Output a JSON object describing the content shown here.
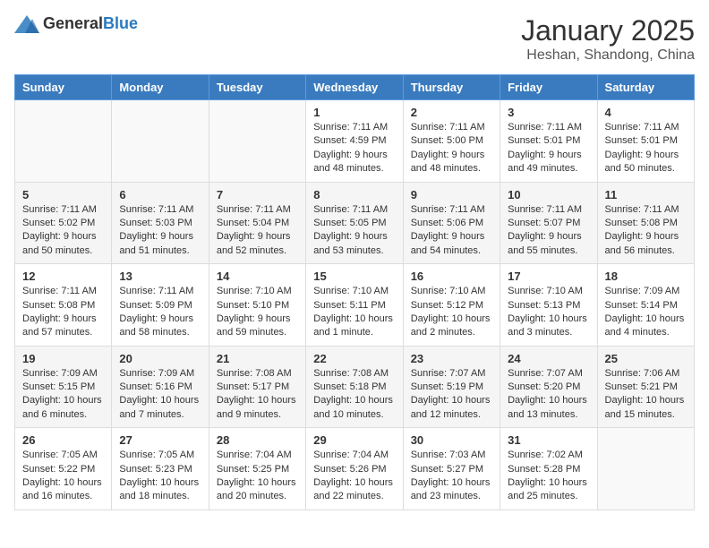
{
  "header": {
    "logo_general": "General",
    "logo_blue": "Blue",
    "month_title": "January 2025",
    "location": "Heshan, Shandong, China"
  },
  "days_of_week": [
    "Sunday",
    "Monday",
    "Tuesday",
    "Wednesday",
    "Thursday",
    "Friday",
    "Saturday"
  ],
  "weeks": [
    {
      "row_bg": "light",
      "days": [
        {
          "num": "",
          "info": ""
        },
        {
          "num": "",
          "info": ""
        },
        {
          "num": "",
          "info": ""
        },
        {
          "num": "1",
          "info": "Sunrise: 7:11 AM\nSunset: 4:59 PM\nDaylight: 9 hours and 48 minutes."
        },
        {
          "num": "2",
          "info": "Sunrise: 7:11 AM\nSunset: 5:00 PM\nDaylight: 9 hours and 48 minutes."
        },
        {
          "num": "3",
          "info": "Sunrise: 7:11 AM\nSunset: 5:01 PM\nDaylight: 9 hours and 49 minutes."
        },
        {
          "num": "4",
          "info": "Sunrise: 7:11 AM\nSunset: 5:01 PM\nDaylight: 9 hours and 50 minutes."
        }
      ]
    },
    {
      "row_bg": "dark",
      "days": [
        {
          "num": "5",
          "info": "Sunrise: 7:11 AM\nSunset: 5:02 PM\nDaylight: 9 hours and 50 minutes."
        },
        {
          "num": "6",
          "info": "Sunrise: 7:11 AM\nSunset: 5:03 PM\nDaylight: 9 hours and 51 minutes."
        },
        {
          "num": "7",
          "info": "Sunrise: 7:11 AM\nSunset: 5:04 PM\nDaylight: 9 hours and 52 minutes."
        },
        {
          "num": "8",
          "info": "Sunrise: 7:11 AM\nSunset: 5:05 PM\nDaylight: 9 hours and 53 minutes."
        },
        {
          "num": "9",
          "info": "Sunrise: 7:11 AM\nSunset: 5:06 PM\nDaylight: 9 hours and 54 minutes."
        },
        {
          "num": "10",
          "info": "Sunrise: 7:11 AM\nSunset: 5:07 PM\nDaylight: 9 hours and 55 minutes."
        },
        {
          "num": "11",
          "info": "Sunrise: 7:11 AM\nSunset: 5:08 PM\nDaylight: 9 hours and 56 minutes."
        }
      ]
    },
    {
      "row_bg": "light",
      "days": [
        {
          "num": "12",
          "info": "Sunrise: 7:11 AM\nSunset: 5:08 PM\nDaylight: 9 hours and 57 minutes."
        },
        {
          "num": "13",
          "info": "Sunrise: 7:11 AM\nSunset: 5:09 PM\nDaylight: 9 hours and 58 minutes."
        },
        {
          "num": "14",
          "info": "Sunrise: 7:10 AM\nSunset: 5:10 PM\nDaylight: 9 hours and 59 minutes."
        },
        {
          "num": "15",
          "info": "Sunrise: 7:10 AM\nSunset: 5:11 PM\nDaylight: 10 hours and 1 minute."
        },
        {
          "num": "16",
          "info": "Sunrise: 7:10 AM\nSunset: 5:12 PM\nDaylight: 10 hours and 2 minutes."
        },
        {
          "num": "17",
          "info": "Sunrise: 7:10 AM\nSunset: 5:13 PM\nDaylight: 10 hours and 3 minutes."
        },
        {
          "num": "18",
          "info": "Sunrise: 7:09 AM\nSunset: 5:14 PM\nDaylight: 10 hours and 4 minutes."
        }
      ]
    },
    {
      "row_bg": "dark",
      "days": [
        {
          "num": "19",
          "info": "Sunrise: 7:09 AM\nSunset: 5:15 PM\nDaylight: 10 hours and 6 minutes."
        },
        {
          "num": "20",
          "info": "Sunrise: 7:09 AM\nSunset: 5:16 PM\nDaylight: 10 hours and 7 minutes."
        },
        {
          "num": "21",
          "info": "Sunrise: 7:08 AM\nSunset: 5:17 PM\nDaylight: 10 hours and 9 minutes."
        },
        {
          "num": "22",
          "info": "Sunrise: 7:08 AM\nSunset: 5:18 PM\nDaylight: 10 hours and 10 minutes."
        },
        {
          "num": "23",
          "info": "Sunrise: 7:07 AM\nSunset: 5:19 PM\nDaylight: 10 hours and 12 minutes."
        },
        {
          "num": "24",
          "info": "Sunrise: 7:07 AM\nSunset: 5:20 PM\nDaylight: 10 hours and 13 minutes."
        },
        {
          "num": "25",
          "info": "Sunrise: 7:06 AM\nSunset: 5:21 PM\nDaylight: 10 hours and 15 minutes."
        }
      ]
    },
    {
      "row_bg": "light",
      "days": [
        {
          "num": "26",
          "info": "Sunrise: 7:05 AM\nSunset: 5:22 PM\nDaylight: 10 hours and 16 minutes."
        },
        {
          "num": "27",
          "info": "Sunrise: 7:05 AM\nSunset: 5:23 PM\nDaylight: 10 hours and 18 minutes."
        },
        {
          "num": "28",
          "info": "Sunrise: 7:04 AM\nSunset: 5:25 PM\nDaylight: 10 hours and 20 minutes."
        },
        {
          "num": "29",
          "info": "Sunrise: 7:04 AM\nSunset: 5:26 PM\nDaylight: 10 hours and 22 minutes."
        },
        {
          "num": "30",
          "info": "Sunrise: 7:03 AM\nSunset: 5:27 PM\nDaylight: 10 hours and 23 minutes."
        },
        {
          "num": "31",
          "info": "Sunrise: 7:02 AM\nSunset: 5:28 PM\nDaylight: 10 hours and 25 minutes."
        },
        {
          "num": "",
          "info": ""
        }
      ]
    }
  ]
}
